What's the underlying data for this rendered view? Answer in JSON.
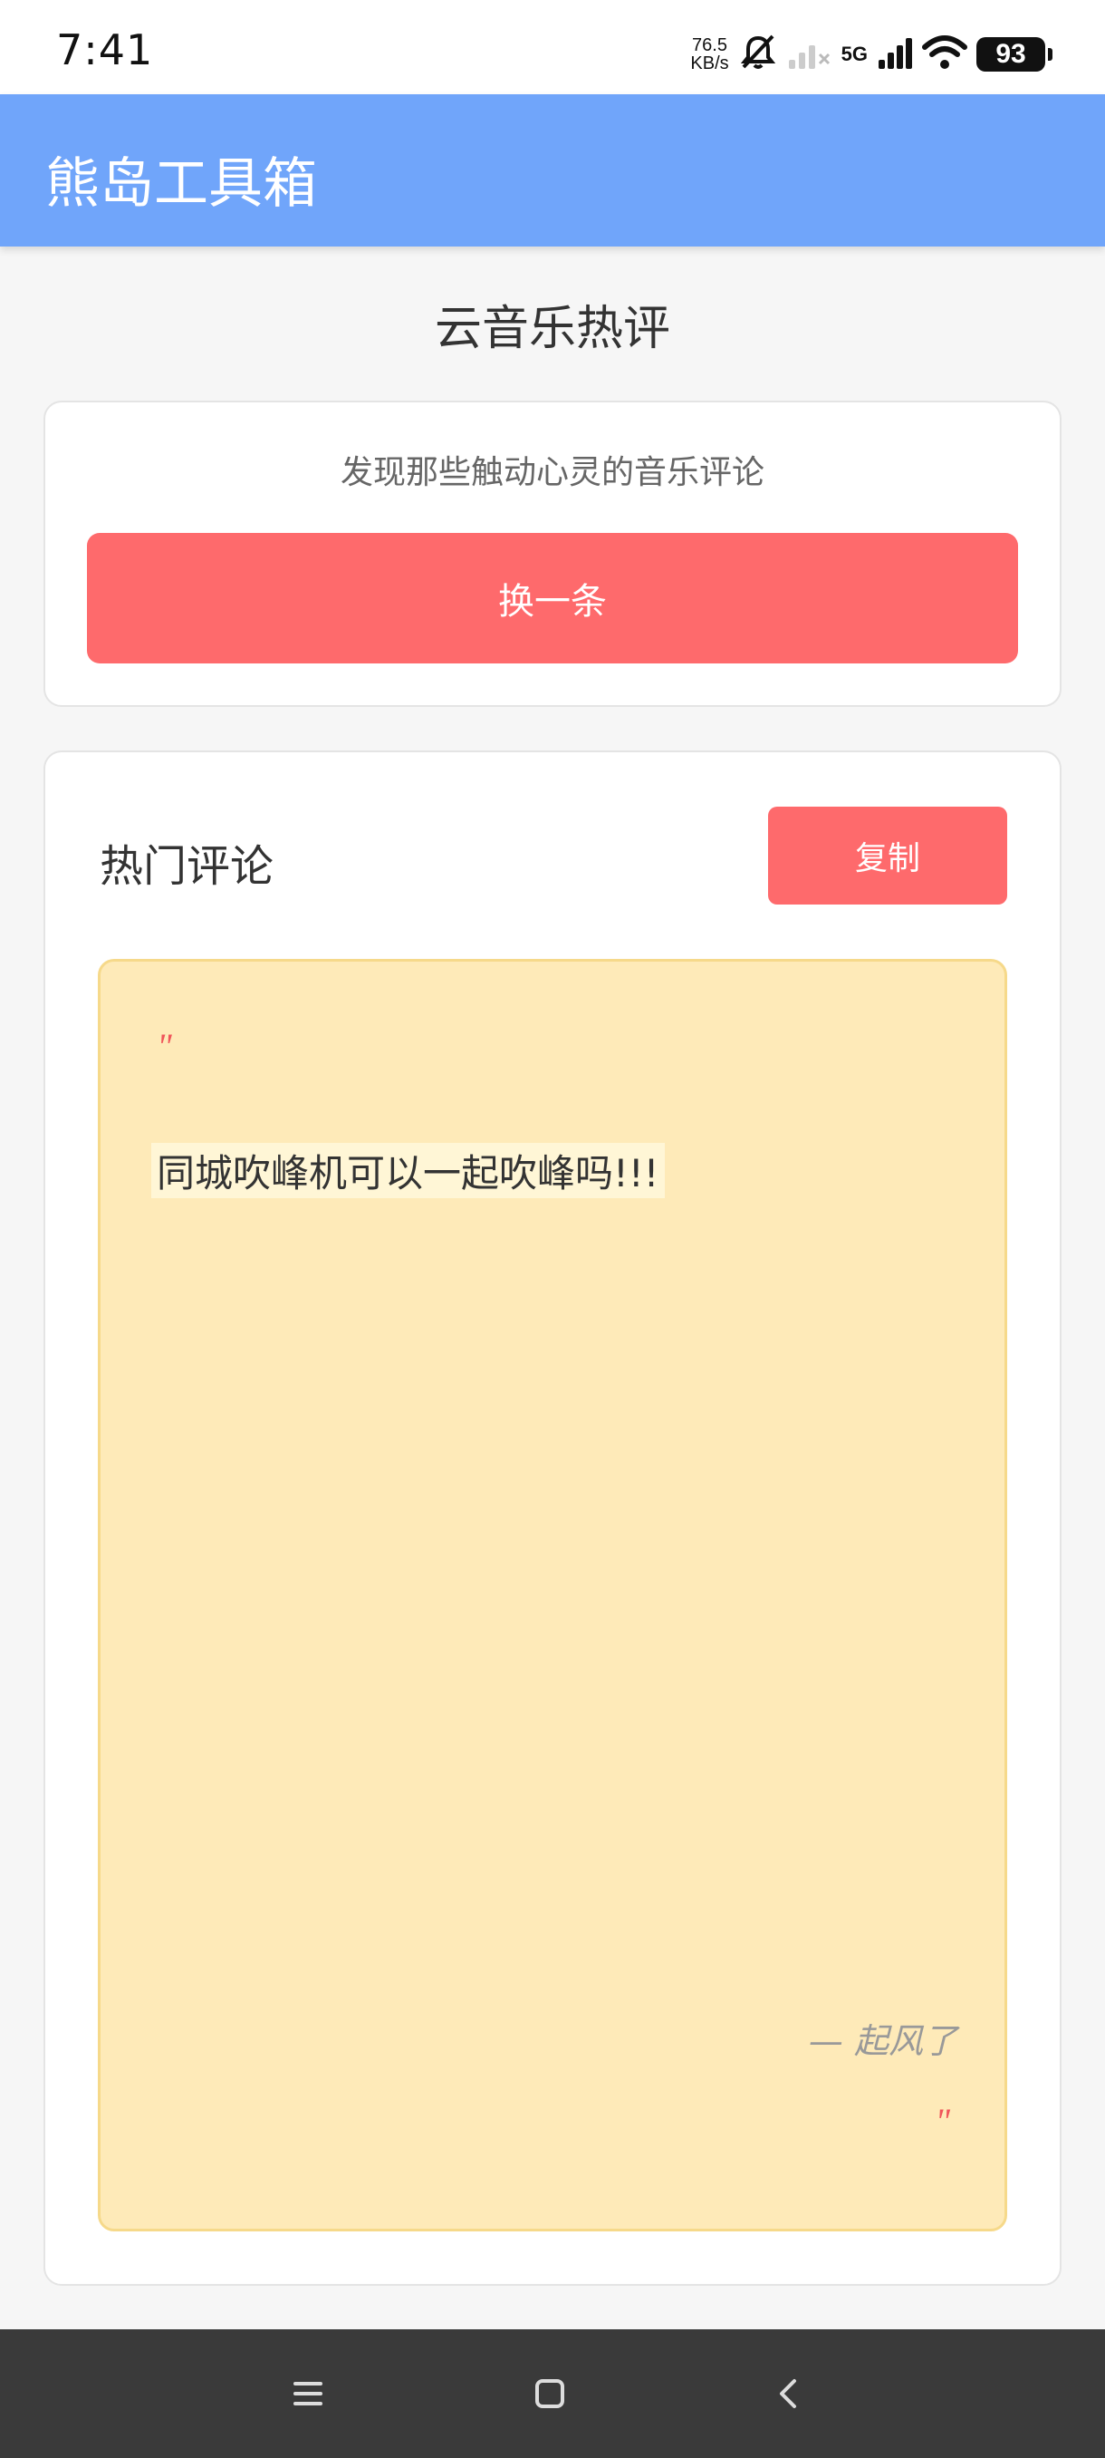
{
  "status_bar": {
    "time": "7:41",
    "net_speed_value": "76.5",
    "net_speed_unit": "KB/s",
    "network": "5G",
    "battery": "93"
  },
  "app": {
    "title": "熊岛工具箱"
  },
  "page": {
    "title": "云音乐热评",
    "tagline": "发现那些触动心灵的音乐评论",
    "refresh_label": "换一条"
  },
  "comment_card": {
    "section_title": "热门评论",
    "copy_label": "复制",
    "quote_open": "\"",
    "quote_close": "\"",
    "text": "同城吹峰机可以一起吹峰吗!!!",
    "author": "— 起风了"
  },
  "nav": {
    "icons": [
      "menu-icon",
      "home-icon",
      "back-icon"
    ]
  },
  "colors": {
    "appbar": "#70a5fa",
    "accent_button": "#fe6a6c",
    "quote_bg": "#feeab8",
    "quote_mark": "#f0555a",
    "navbar": "#3a3a3a"
  }
}
